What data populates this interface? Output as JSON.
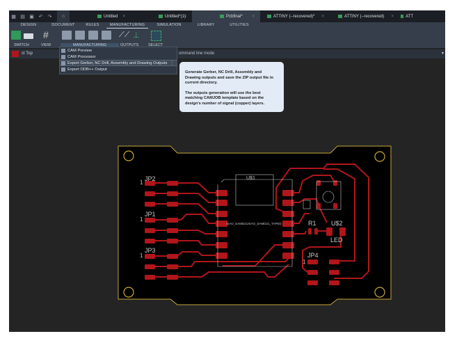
{
  "tabs": {
    "quick_access": [
      "grid-icon",
      "file-icon",
      "save-icon",
      "undo-icon",
      "redo-icon"
    ],
    "documents": [
      {
        "label": "Untitled",
        "active": false
      },
      {
        "label": "Untitled*(1)",
        "active": false
      },
      {
        "label": "Pcbfinal*",
        "active": true
      },
      {
        "label": "ATTINY (--recovered)*",
        "active": false
      },
      {
        "label": "ATTINY (--recovered)",
        "active": false
      },
      {
        "label": "ATT",
        "active": false
      }
    ]
  },
  "ribbon_tabs": [
    "DESIGN",
    "DOCUMENT",
    "RULES",
    "MANUFACTURING",
    "SIMULATION",
    "LIBRARY",
    "UTILITIES"
  ],
  "active_ribbon_tab": "MANUFACTURING",
  "groups": {
    "switch": "SWITCH",
    "view": "VIEW",
    "manufacturing": "MANUFACTURING",
    "outputs": "OUTPUTS",
    "select": "SELECT"
  },
  "cmdbar": {
    "layer": "ct Top",
    "layer_color": "#b0161a",
    "command_placeholder": "ommand line mode"
  },
  "menu": {
    "items": [
      "CAM Preview",
      "CAM Processor",
      "Export Gerber, NC Drill, Assembly and Drawing Outputs",
      "Export ODB++ Output"
    ],
    "highlighted": 2
  },
  "tooltip": {
    "p1": "Generate Gerber, NC Drill, Assembly and Drawing outputs and save the ZIP output file in current directory.",
    "p2": "The outputs generation will use the best matching CAMJOB template based on the design's number of signal (copper) layers."
  },
  "pcb": {
    "labels": {
      "jp2": "JP2",
      "jp1": "JP1",
      "jp3": "JP3",
      "jp4": "JP4",
      "u1": "U$1",
      "u2": "U$2",
      "r1": "R1",
      "led": "LED",
      "xiao": "XIAO_SAMD21XIAO_SAMD21_TAPED",
      "pin1": "1"
    },
    "colors": {
      "copper": "#b0161a",
      "outline": "#c8a838",
      "silk": "#c8c8c8"
    }
  }
}
